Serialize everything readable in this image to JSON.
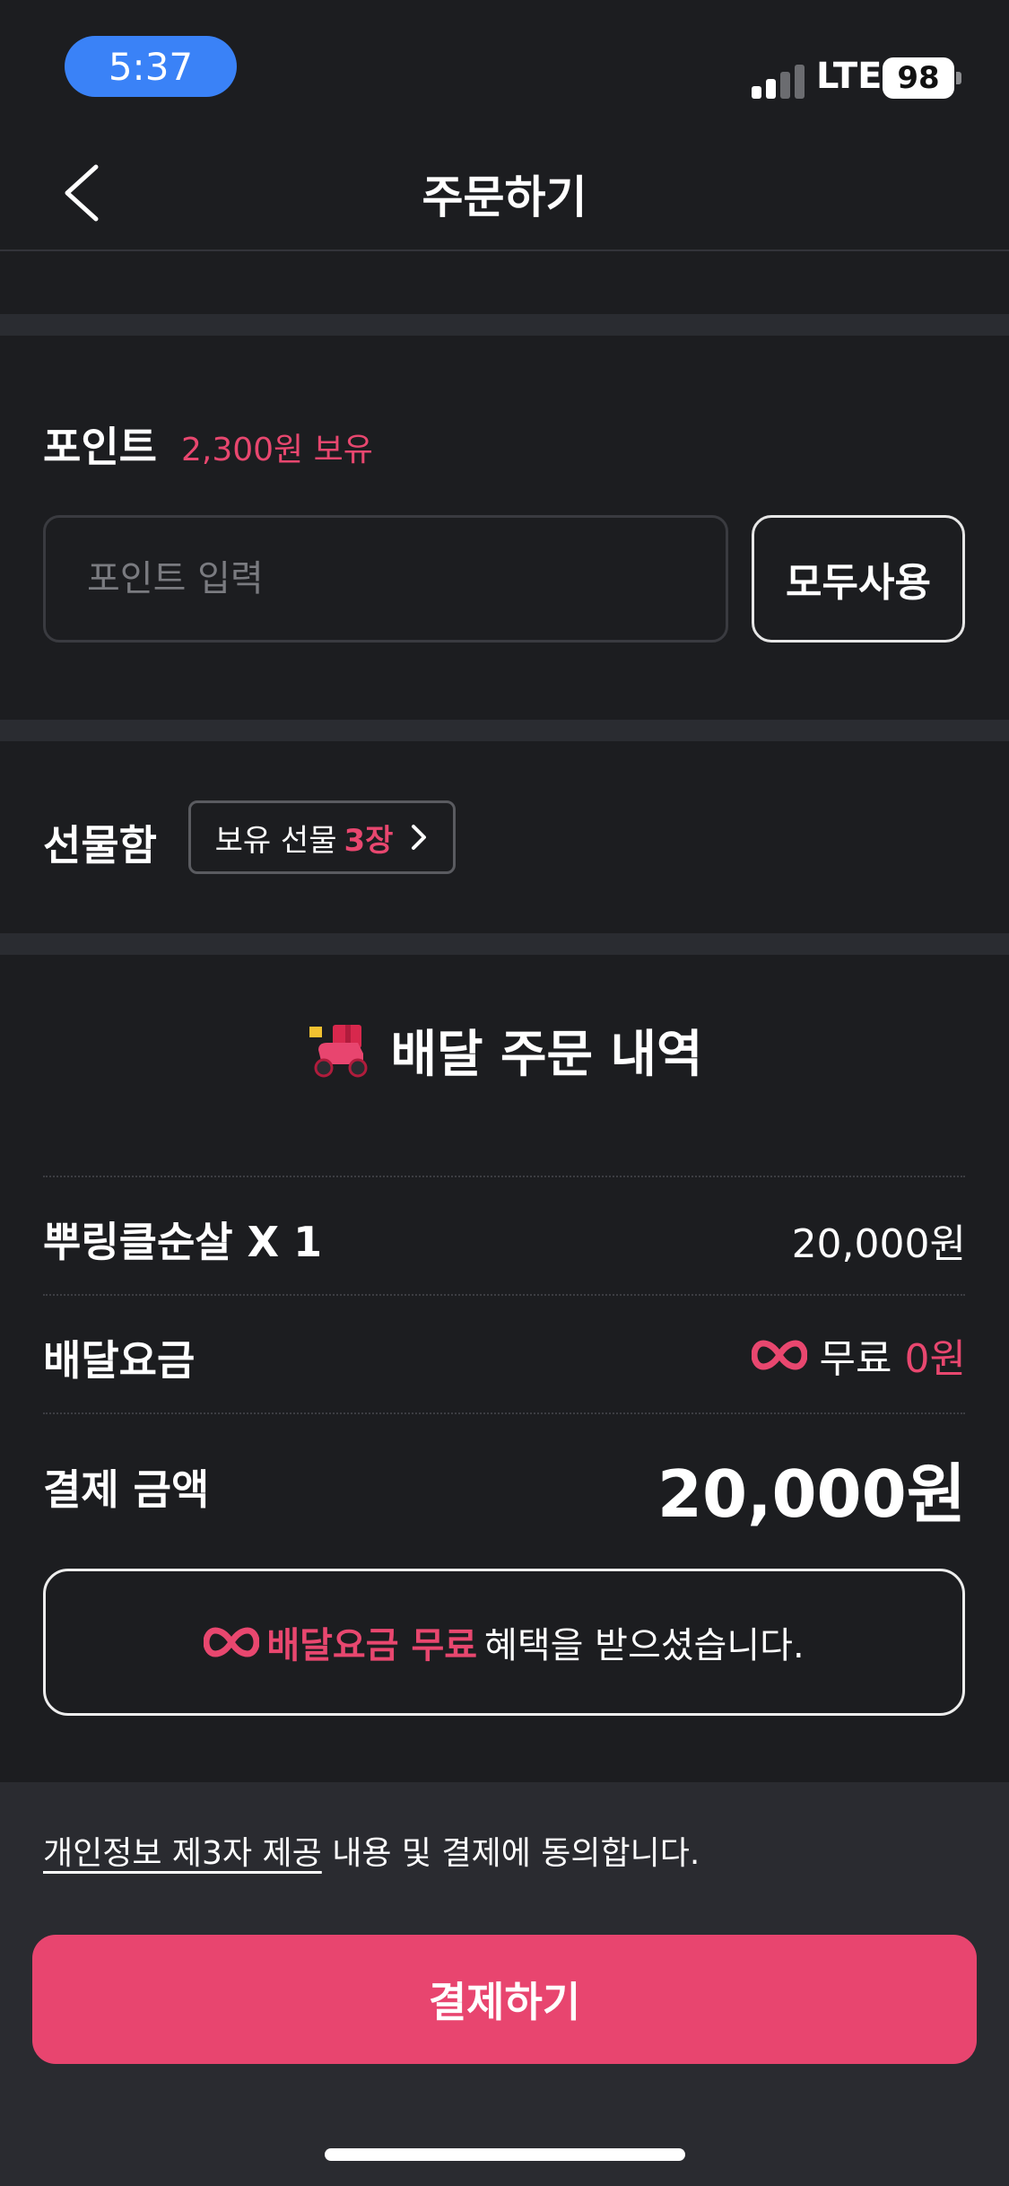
{
  "status_bar": {
    "time": "5:37",
    "network": "LTE",
    "battery": "98"
  },
  "header": {
    "title": "주문하기",
    "back_icon": "chevron-left-icon"
  },
  "points": {
    "label": "포인트",
    "balance": "2,300원 보유",
    "input_placeholder": "포인트 입력",
    "input_value": "",
    "use_all_label": "모두사용"
  },
  "gift_box": {
    "label": "선물함",
    "chip_prefix": "보유 선물",
    "chip_count": "3장",
    "chevron_icon": "chevron-right-icon"
  },
  "order": {
    "icon": "delivery-scooter-icon",
    "title": "배달 주문 내역",
    "items": [
      {
        "label": "뿌링클순살 X 1",
        "value": "20,000원"
      }
    ],
    "delivery_fee": {
      "label": "배달요금",
      "badge_icon": "infinity-icon",
      "free_text": "무료",
      "amount": "0원"
    },
    "total": {
      "label": "결제 금액",
      "value": "20,000원"
    },
    "benefit": {
      "icon": "infinity-icon",
      "strong": "배달요금 무료",
      "rest": "혜택을 받으셨습니다."
    }
  },
  "footer": {
    "consent_link": "개인정보 제3자 제공",
    "consent_rest": "내용 및 결제에 동의합니다.",
    "pay_label": "결제하기"
  },
  "colors": {
    "background": "#1c1d20",
    "band": "#2a2c31",
    "accent": "#e8456f",
    "status_pill": "#3a82f7"
  }
}
